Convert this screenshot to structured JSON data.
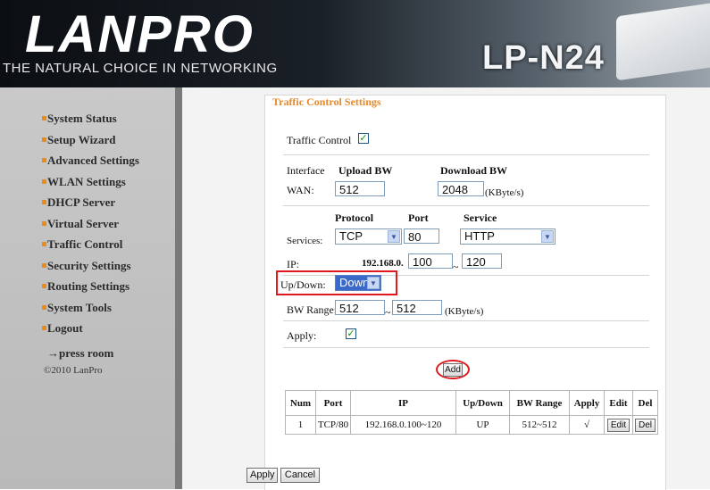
{
  "header": {
    "brand": "LANPRO",
    "tagline": "THE NATURAL CHOICE IN NETWORKING",
    "model": "LP-N24"
  },
  "sidebar": {
    "items": [
      {
        "label": "System Status"
      },
      {
        "label": "Setup Wizard"
      },
      {
        "label": "Advanced Settings"
      },
      {
        "label": "WLAN Settings"
      },
      {
        "label": "DHCP Server"
      },
      {
        "label": "Virtual Server"
      },
      {
        "label": "Traffic Control"
      },
      {
        "label": "Security Settings"
      },
      {
        "label": "Routing Settings"
      },
      {
        "label": "System Tools"
      },
      {
        "label": "Logout"
      }
    ],
    "press_room": "→press room",
    "copyright": "©2010 LanPro"
  },
  "page": {
    "title": "Traffic Control Settings",
    "traffic_control_label": "Traffic Control",
    "traffic_control_checked": true,
    "interface_label": "Interface",
    "upload_bw_label": "Upload BW",
    "download_bw_label": "Download BW",
    "wan_label": "WAN:",
    "upload_bw_value": "512",
    "download_bw_value": "2048",
    "bw_unit": "(KByte/s)",
    "protocol_label": "Protocol",
    "port_label": "Port",
    "service_label": "Service",
    "services_label": "Services:",
    "protocol_value": "TCP",
    "port_value": "80",
    "service_value": "HTTP",
    "ip_label": "IP:",
    "ip_prefix": "192.168.0.",
    "ip_start": "100",
    "ip_tilde": "~",
    "ip_end": "120",
    "updown_label": "Up/Down:",
    "updown_value": "Down",
    "bw_range_label": "BW Range:",
    "bw_range_start": "512",
    "bw_range_tilde": "~",
    "bw_range_end": "512",
    "bw_range_unit": "(KByte/s)",
    "apply_label": "Apply:",
    "apply_checked": true,
    "add_button": "Add",
    "apply_button": "Apply",
    "cancel_button": "Cancel",
    "highlight_color": "#e0191e",
    "title_color": "#e8892a"
  },
  "rules_table": {
    "headers": [
      "Num",
      "Port",
      "IP",
      "Up/Down",
      "BW Range",
      "Apply",
      "Edit",
      "Del"
    ],
    "rows": [
      {
        "num": "1",
        "port": "TCP/80",
        "ip": "192.168.0.100~120",
        "updown": "UP",
        "bw_range": "512~512",
        "apply": "√",
        "edit": "Edit",
        "del": "Del"
      }
    ]
  }
}
